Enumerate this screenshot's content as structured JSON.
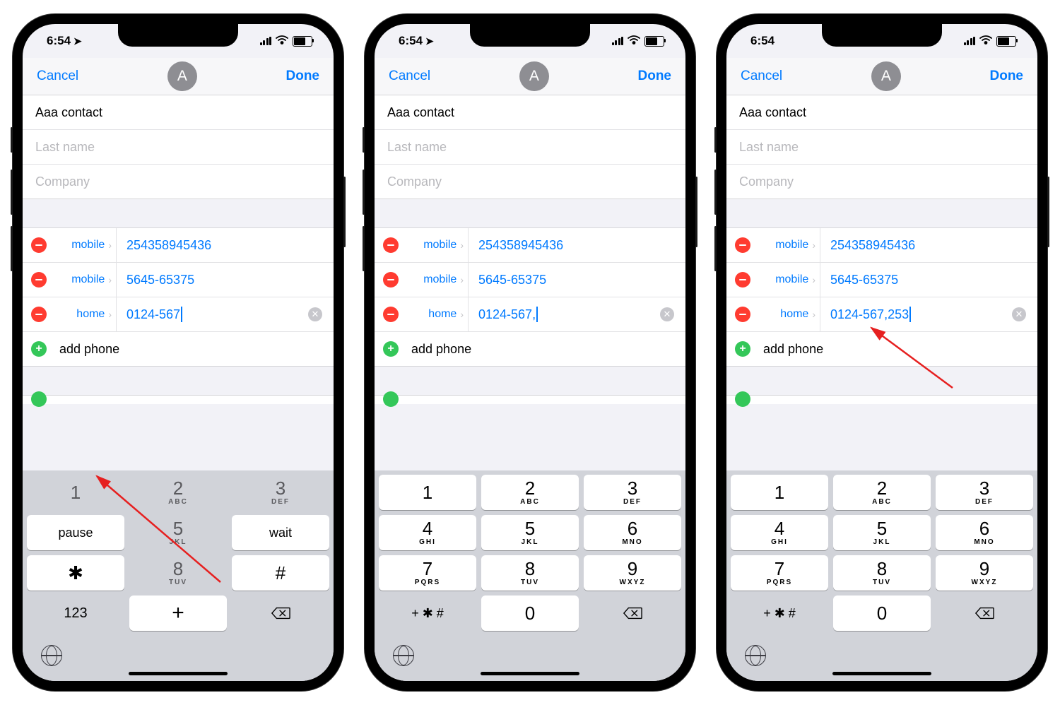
{
  "screens": [
    {
      "time": "6:54",
      "loc_icon": true,
      "cancel": "Cancel",
      "done": "Done",
      "avatar": "A",
      "first_name": "Aaa contact",
      "last_name_ph": "Last name",
      "company_ph": "Company",
      "phones": [
        {
          "label": "mobile",
          "value": "254358945436",
          "active": false
        },
        {
          "label": "mobile",
          "value": "5645-65375",
          "active": false
        },
        {
          "label": "home",
          "value": "0124-567",
          "active": true
        }
      ],
      "add_phone": "add phone",
      "keypad_mode": "symbols",
      "keys_sym": {
        "r1": [
          {
            "n": "1"
          },
          {
            "n": "2",
            "s": "ABC"
          },
          {
            "n": "3",
            "s": "DEF"
          }
        ],
        "r2": [
          {
            "n": "pause"
          },
          {
            "n": "5",
            "s": "JKL"
          },
          {
            "n": "wait"
          }
        ],
        "r3": [
          {
            "n": "✱"
          },
          {
            "n": "8",
            "s": "TUV"
          },
          {
            "n": "#"
          }
        ],
        "bottom_left": "123",
        "zero": "+"
      },
      "arrow": true
    },
    {
      "time": "6:54",
      "loc_icon": true,
      "cancel": "Cancel",
      "done": "Done",
      "avatar": "A",
      "first_name": "Aaa contact",
      "last_name_ph": "Last name",
      "company_ph": "Company",
      "phones": [
        {
          "label": "mobile",
          "value": "254358945436",
          "active": false
        },
        {
          "label": "mobile",
          "value": "5645-65375",
          "active": false
        },
        {
          "label": "home",
          "value": "0124-567,",
          "active": true
        }
      ],
      "add_phone": "add phone",
      "keypad_mode": "numbers",
      "keys_num": {
        "rows": [
          [
            {
              "n": "1"
            },
            {
              "n": "2",
              "s": "ABC"
            },
            {
              "n": "3",
              "s": "DEF"
            }
          ],
          [
            {
              "n": "4",
              "s": "GHI"
            },
            {
              "n": "5",
              "s": "JKL"
            },
            {
              "n": "6",
              "s": "MNO"
            }
          ],
          [
            {
              "n": "7",
              "s": "PQRS"
            },
            {
              "n": "8",
              "s": "TUV"
            },
            {
              "n": "9",
              "s": "WXYZ"
            }
          ]
        ],
        "bottom_left": "+ ✱ #",
        "zero": "0"
      }
    },
    {
      "time": "6:54",
      "loc_icon": false,
      "cancel": "Cancel",
      "done": "Done",
      "avatar": "A",
      "first_name": "Aaa contact",
      "last_name_ph": "Last name",
      "company_ph": "Company",
      "phones": [
        {
          "label": "mobile",
          "value": "254358945436",
          "active": false
        },
        {
          "label": "mobile",
          "value": "5645-65375",
          "active": false
        },
        {
          "label": "home",
          "value": "0124-567,253",
          "active": true
        }
      ],
      "add_phone": "add phone",
      "keypad_mode": "numbers",
      "keys_num": {
        "rows": [
          [
            {
              "n": "1"
            },
            {
              "n": "2",
              "s": "ABC"
            },
            {
              "n": "3",
              "s": "DEF"
            }
          ],
          [
            {
              "n": "4",
              "s": "GHI"
            },
            {
              "n": "5",
              "s": "JKL"
            },
            {
              "n": "6",
              "s": "MNO"
            }
          ],
          [
            {
              "n": "7",
              "s": "PQRS"
            },
            {
              "n": "8",
              "s": "TUV"
            },
            {
              "n": "9",
              "s": "WXYZ"
            }
          ]
        ],
        "bottom_left": "+ ✱ #",
        "zero": "0"
      },
      "arrow2": true
    }
  ]
}
